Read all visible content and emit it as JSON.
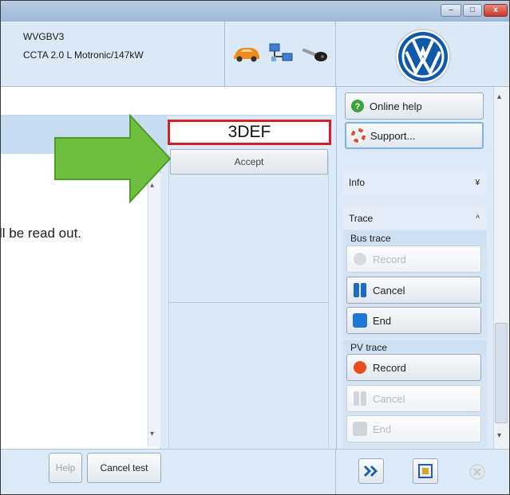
{
  "window": {
    "minimize_glyph": "–",
    "maximize_glyph": "□",
    "close_glyph": "x"
  },
  "vehicle": {
    "id": "WVGBV3",
    "description": "CCTA 2.0 L Motronic/147kW"
  },
  "icons": {
    "car": "car-icon",
    "network": "network-icon",
    "key": "key-icon",
    "logo": "vw-logo"
  },
  "code_entry": {
    "value": "3DEF",
    "accept_label": "Accept"
  },
  "content": {
    "visible_text": "ll be read out."
  },
  "bottom": {
    "help_label": "Help",
    "cancel_test_label": "Cancel test"
  },
  "sidebar": {
    "online_help_label": "Online help",
    "support_label": "Support...",
    "info_label": "Info",
    "trace_label": "Trace",
    "bus_trace_label": "Bus trace",
    "bus_trace": {
      "record": "Record",
      "cancel": "Cancel",
      "end": "End"
    },
    "pv_trace_label": "PV trace",
    "pv_trace": {
      "record": "Record",
      "cancel": "Cancel",
      "end": "End"
    }
  },
  "colors": {
    "accent_red": "#d31f26",
    "arrow_green": "#6fbf3e",
    "panel_blue": "#dbe8f5"
  }
}
